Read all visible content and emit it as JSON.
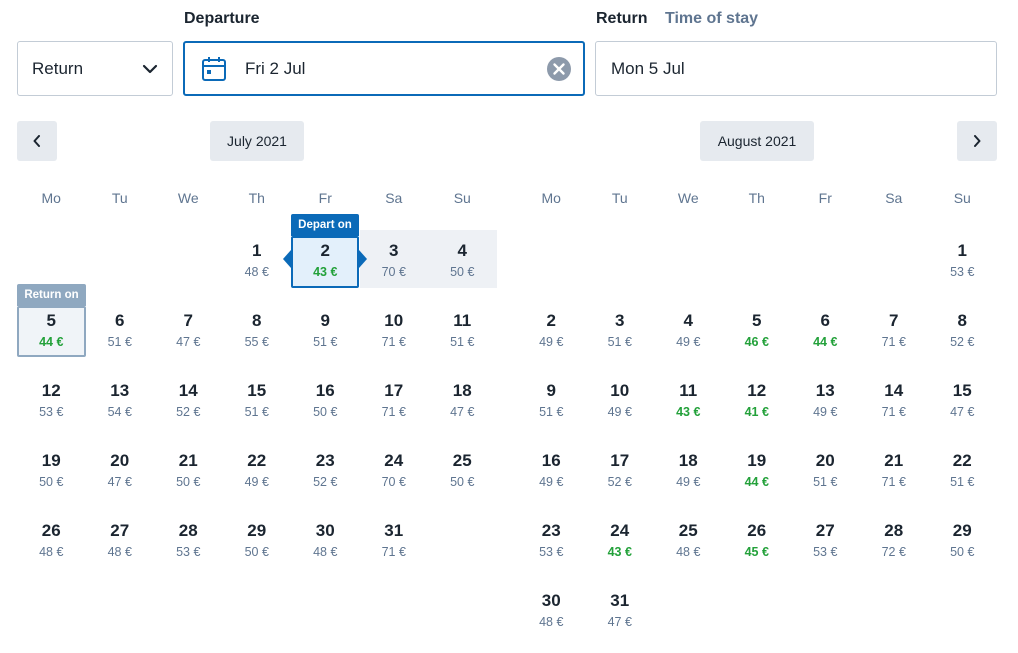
{
  "labels": {
    "departure": "Departure",
    "return": "Return",
    "time_of_stay": "Time of stay"
  },
  "trip_type": {
    "value": "Return"
  },
  "departure_field": {
    "value": "Fri 2 Jul"
  },
  "return_field": {
    "value": "Mon 5 Jul"
  },
  "tags": {
    "depart_on": "Depart on",
    "return_on": "Return on"
  },
  "colors": {
    "accent": "#0b6ab8",
    "cheap_price": "#23a13a",
    "muted": "#5f7590",
    "return_tag": "#8fa8c0"
  },
  "weekdays": [
    "Mo",
    "Tu",
    "We",
    "Th",
    "Fr",
    "Sa",
    "Su"
  ],
  "months": [
    {
      "label": "July 2021",
      "first_weekday": 3,
      "days": [
        {
          "d": "1",
          "p": "48 €"
        },
        {
          "d": "2",
          "p": "43 €",
          "cheap": true,
          "sel": "depart"
        },
        {
          "d": "3",
          "p": "70 €"
        },
        {
          "d": "4",
          "p": "50 €"
        },
        {
          "d": "5",
          "p": "44 €",
          "cheap": true,
          "sel": "return"
        },
        {
          "d": "6",
          "p": "51 €"
        },
        {
          "d": "7",
          "p": "47 €"
        },
        {
          "d": "8",
          "p": "55 €"
        },
        {
          "d": "9",
          "p": "51 €"
        },
        {
          "d": "10",
          "p": "71 €"
        },
        {
          "d": "11",
          "p": "51 €"
        },
        {
          "d": "12",
          "p": "53 €"
        },
        {
          "d": "13",
          "p": "54 €"
        },
        {
          "d": "14",
          "p": "52 €"
        },
        {
          "d": "15",
          "p": "51 €"
        },
        {
          "d": "16",
          "p": "50 €"
        },
        {
          "d": "17",
          "p": "71 €"
        },
        {
          "d": "18",
          "p": "47 €"
        },
        {
          "d": "19",
          "p": "50 €"
        },
        {
          "d": "20",
          "p": "47 €"
        },
        {
          "d": "21",
          "p": "50 €"
        },
        {
          "d": "22",
          "p": "49 €"
        },
        {
          "d": "23",
          "p": "52 €"
        },
        {
          "d": "24",
          "p": "70 €"
        },
        {
          "d": "25",
          "p": "50 €"
        },
        {
          "d": "26",
          "p": "48 €"
        },
        {
          "d": "27",
          "p": "48 €"
        },
        {
          "d": "28",
          "p": "53 €"
        },
        {
          "d": "29",
          "p": "50 €"
        },
        {
          "d": "30",
          "p": "48 €"
        },
        {
          "d": "31",
          "p": "71 €"
        }
      ]
    },
    {
      "label": "August 2021",
      "first_weekday": 6,
      "days": [
        {
          "d": "1",
          "p": "53 €"
        },
        {
          "d": "2",
          "p": "49 €"
        },
        {
          "d": "3",
          "p": "51 €"
        },
        {
          "d": "4",
          "p": "49 €"
        },
        {
          "d": "5",
          "p": "46 €",
          "cheap": true
        },
        {
          "d": "6",
          "p": "44 €",
          "cheap": true
        },
        {
          "d": "7",
          "p": "71 €"
        },
        {
          "d": "8",
          "p": "52 €"
        },
        {
          "d": "9",
          "p": "51 €"
        },
        {
          "d": "10",
          "p": "49 €"
        },
        {
          "d": "11",
          "p": "43 €",
          "cheap": true
        },
        {
          "d": "12",
          "p": "41 €",
          "cheap": true
        },
        {
          "d": "13",
          "p": "49 €"
        },
        {
          "d": "14",
          "p": "71 €"
        },
        {
          "d": "15",
          "p": "47 €"
        },
        {
          "d": "16",
          "p": "49 €"
        },
        {
          "d": "17",
          "p": "52 €"
        },
        {
          "d": "18",
          "p": "49 €"
        },
        {
          "d": "19",
          "p": "44 €",
          "cheap": true
        },
        {
          "d": "20",
          "p": "51 €"
        },
        {
          "d": "21",
          "p": "71 €"
        },
        {
          "d": "22",
          "p": "51 €"
        },
        {
          "d": "23",
          "p": "53 €"
        },
        {
          "d": "24",
          "p": "43 €",
          "cheap": true
        },
        {
          "d": "25",
          "p": "48 €"
        },
        {
          "d": "26",
          "p": "45 €",
          "cheap": true
        },
        {
          "d": "27",
          "p": "53 €"
        },
        {
          "d": "28",
          "p": "72 €"
        },
        {
          "d": "29",
          "p": "50 €"
        },
        {
          "d": "30",
          "p": "48 €"
        },
        {
          "d": "31",
          "p": "47 €"
        }
      ]
    }
  ]
}
